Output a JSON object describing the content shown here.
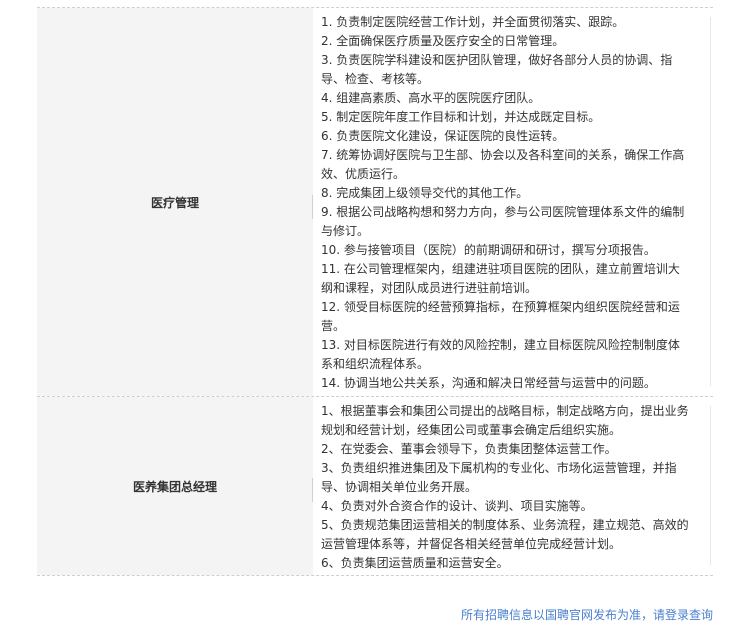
{
  "sections": [
    {
      "title": "医疗管理",
      "lines": [
        "1. 负责制定医院经营工作计划，并全面贯彻落实、跟踪。",
        "2. 全面确保医疗质量及医疗安全的日常管理。",
        "3. 负责医院学科建设和医护团队管理，做好各部分人员的协调、指",
        "导、检查、考核等。",
        "4. 组建高素质、高水平的医院医疗团队。",
        "5. 制定医院年度工作目标和计划，并达成既定目标。",
        "6. 负责医院文化建设，保证医院的良性运转。",
        "7. 统筹协调好医院与卫生部、协会以及各科室间的关系，确保工作高",
        "效、优质运行。",
        "8. 完成集团上级领导交代的其他工作。",
        "9. 根据公司战略构想和努力方向，参与公司医院管理体系文件的编制",
        "与修订。",
        "10. 参与接管项目（医院）的前期调研和研讨，撰写分项报告。",
        "11. 在公司管理框架内，组建进驻项目医院的团队，建立前置培训大",
        "纲和课程，对团队成员进行进驻前培训。",
        "12. 领受目标医院的经营预算指标，在预算框架内组织医院经营和运",
        "营。",
        "13. 对目标医院进行有效的风险控制，建立目标医院风险控制制度体",
        "系和组织流程体系。",
        "14. 协调当地公共关系，沟通和解决日常经营与运营中的问题。"
      ]
    },
    {
      "title": "医养集团总经理",
      "lines": [
        "1、根据董事会和集团公司提出的战略目标，制定战略方向，提出业务",
        "规划和经营计划，经集团公司或董事会确定后组织实施。",
        "2、在党委会、董事会领导下，负责集团整体运营工作。",
        "3、负责组织推进集团及下属机构的专业化、市场化运营管理，并指",
        "导、协调相关单位业务开展。",
        "4、负责对外合资合作的设计、谈判、项目实施等。",
        "5、负责规范集团运营相关的制度体系、业务流程，建立规范、高效的",
        "运营管理体系等，并督促各相关经营单位完成经营计划。",
        "6、负责集团运营质量和运营安全。"
      ]
    }
  ],
  "footer_link": "所有招聘信息以国聘官网发布为准，请登录查询"
}
